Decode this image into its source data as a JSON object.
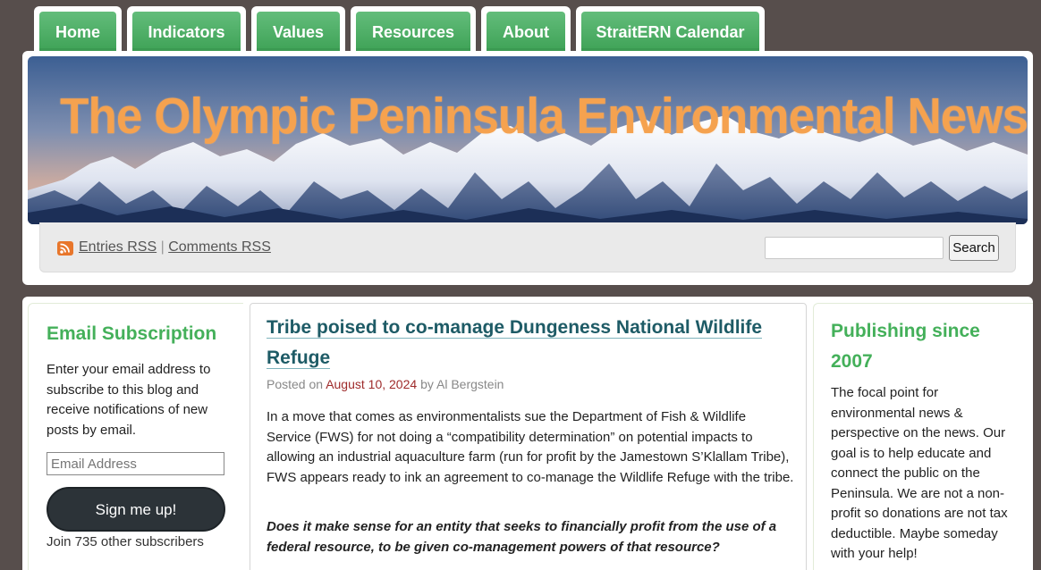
{
  "nav": {
    "tabs": [
      {
        "label": "Home"
      },
      {
        "label": "Indicators"
      },
      {
        "label": "Values"
      },
      {
        "label": "Resources"
      },
      {
        "label": "About"
      },
      {
        "label": "StraitERN Calendar"
      }
    ]
  },
  "header": {
    "banner_title": "The Olympic Peninsula Environmental News",
    "rss": {
      "entries_label": "Entries RSS",
      "separator": "|",
      "comments_label": "Comments RSS"
    },
    "search": {
      "value": "",
      "button_label": "Search"
    }
  },
  "left_sidebar": {
    "title": "Email Subscription",
    "description": "Enter your email address to subscribe to this blog and receive notifications of new posts by email.",
    "email_placeholder": "Email Address",
    "signup_label": "Sign me up!",
    "subscribers_text": "Join 735 other subscribers"
  },
  "post": {
    "title": "Tribe poised to co-manage Dungeness National Wildlife Refuge",
    "posted_on_label": "Posted on",
    "date": "August 10, 2024",
    "by_label": "by",
    "author": "Al Bergstein",
    "paragraph": "In a move that comes as environmentalists sue the Department of Fish & Wildlife Service (FWS) for not doing a “compatibility determination” on potential impacts to allowing an industrial aquaculture farm (run for profit by the Jamestown S’Klallam Tribe), FWS appears ready to ink an agreement to co-manage the Wildlife Refuge with the tribe.",
    "question": "Does it make sense for an entity that seeks to financially profit from the use of a federal resource, to be given co-management powers of that resource?"
  },
  "right_sidebar": {
    "title": "Publishing since 2007",
    "description": "The focal point for environmental news & perspective on the news. Our goal is to help educate and connect the public on the Peninsula. We are not a non-profit so donations are not tax deductible. Maybe someday with your help!"
  },
  "colors": {
    "accent_green": "#44b05a",
    "title_teal": "#1e5b66",
    "date_red": "#9e2a2a",
    "page_bg": "#574e4c",
    "banner_text": "#f5a24f"
  }
}
